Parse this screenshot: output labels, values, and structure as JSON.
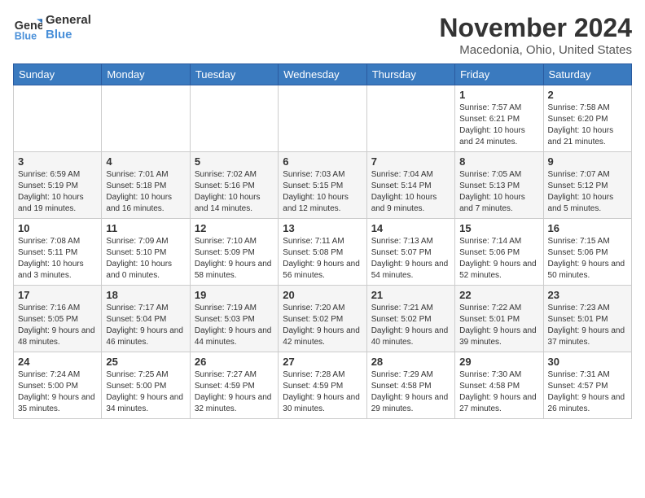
{
  "header": {
    "logo_line1": "General",
    "logo_line2": "Blue",
    "month": "November 2024",
    "location": "Macedonia, Ohio, United States"
  },
  "days_of_week": [
    "Sunday",
    "Monday",
    "Tuesday",
    "Wednesday",
    "Thursday",
    "Friday",
    "Saturday"
  ],
  "weeks": [
    [
      {
        "day": "",
        "info": ""
      },
      {
        "day": "",
        "info": ""
      },
      {
        "day": "",
        "info": ""
      },
      {
        "day": "",
        "info": ""
      },
      {
        "day": "",
        "info": ""
      },
      {
        "day": "1",
        "info": "Sunrise: 7:57 AM\nSunset: 6:21 PM\nDaylight: 10 hours and 24 minutes."
      },
      {
        "day": "2",
        "info": "Sunrise: 7:58 AM\nSunset: 6:20 PM\nDaylight: 10 hours and 21 minutes."
      }
    ],
    [
      {
        "day": "3",
        "info": "Sunrise: 6:59 AM\nSunset: 5:19 PM\nDaylight: 10 hours and 19 minutes."
      },
      {
        "day": "4",
        "info": "Sunrise: 7:01 AM\nSunset: 5:18 PM\nDaylight: 10 hours and 16 minutes."
      },
      {
        "day": "5",
        "info": "Sunrise: 7:02 AM\nSunset: 5:16 PM\nDaylight: 10 hours and 14 minutes."
      },
      {
        "day": "6",
        "info": "Sunrise: 7:03 AM\nSunset: 5:15 PM\nDaylight: 10 hours and 12 minutes."
      },
      {
        "day": "7",
        "info": "Sunrise: 7:04 AM\nSunset: 5:14 PM\nDaylight: 10 hours and 9 minutes."
      },
      {
        "day": "8",
        "info": "Sunrise: 7:05 AM\nSunset: 5:13 PM\nDaylight: 10 hours and 7 minutes."
      },
      {
        "day": "9",
        "info": "Sunrise: 7:07 AM\nSunset: 5:12 PM\nDaylight: 10 hours and 5 minutes."
      }
    ],
    [
      {
        "day": "10",
        "info": "Sunrise: 7:08 AM\nSunset: 5:11 PM\nDaylight: 10 hours and 3 minutes."
      },
      {
        "day": "11",
        "info": "Sunrise: 7:09 AM\nSunset: 5:10 PM\nDaylight: 10 hours and 0 minutes."
      },
      {
        "day": "12",
        "info": "Sunrise: 7:10 AM\nSunset: 5:09 PM\nDaylight: 9 hours and 58 minutes."
      },
      {
        "day": "13",
        "info": "Sunrise: 7:11 AM\nSunset: 5:08 PM\nDaylight: 9 hours and 56 minutes."
      },
      {
        "day": "14",
        "info": "Sunrise: 7:13 AM\nSunset: 5:07 PM\nDaylight: 9 hours and 54 minutes."
      },
      {
        "day": "15",
        "info": "Sunrise: 7:14 AM\nSunset: 5:06 PM\nDaylight: 9 hours and 52 minutes."
      },
      {
        "day": "16",
        "info": "Sunrise: 7:15 AM\nSunset: 5:06 PM\nDaylight: 9 hours and 50 minutes."
      }
    ],
    [
      {
        "day": "17",
        "info": "Sunrise: 7:16 AM\nSunset: 5:05 PM\nDaylight: 9 hours and 48 minutes."
      },
      {
        "day": "18",
        "info": "Sunrise: 7:17 AM\nSunset: 5:04 PM\nDaylight: 9 hours and 46 minutes."
      },
      {
        "day": "19",
        "info": "Sunrise: 7:19 AM\nSunset: 5:03 PM\nDaylight: 9 hours and 44 minutes."
      },
      {
        "day": "20",
        "info": "Sunrise: 7:20 AM\nSunset: 5:02 PM\nDaylight: 9 hours and 42 minutes."
      },
      {
        "day": "21",
        "info": "Sunrise: 7:21 AM\nSunset: 5:02 PM\nDaylight: 9 hours and 40 minutes."
      },
      {
        "day": "22",
        "info": "Sunrise: 7:22 AM\nSunset: 5:01 PM\nDaylight: 9 hours and 39 minutes."
      },
      {
        "day": "23",
        "info": "Sunrise: 7:23 AM\nSunset: 5:01 PM\nDaylight: 9 hours and 37 minutes."
      }
    ],
    [
      {
        "day": "24",
        "info": "Sunrise: 7:24 AM\nSunset: 5:00 PM\nDaylight: 9 hours and 35 minutes."
      },
      {
        "day": "25",
        "info": "Sunrise: 7:25 AM\nSunset: 5:00 PM\nDaylight: 9 hours and 34 minutes."
      },
      {
        "day": "26",
        "info": "Sunrise: 7:27 AM\nSunset: 4:59 PM\nDaylight: 9 hours and 32 minutes."
      },
      {
        "day": "27",
        "info": "Sunrise: 7:28 AM\nSunset: 4:59 PM\nDaylight: 9 hours and 30 minutes."
      },
      {
        "day": "28",
        "info": "Sunrise: 7:29 AM\nSunset: 4:58 PM\nDaylight: 9 hours and 29 minutes."
      },
      {
        "day": "29",
        "info": "Sunrise: 7:30 AM\nSunset: 4:58 PM\nDaylight: 9 hours and 27 minutes."
      },
      {
        "day": "30",
        "info": "Sunrise: 7:31 AM\nSunset: 4:57 PM\nDaylight: 9 hours and 26 minutes."
      }
    ]
  ]
}
